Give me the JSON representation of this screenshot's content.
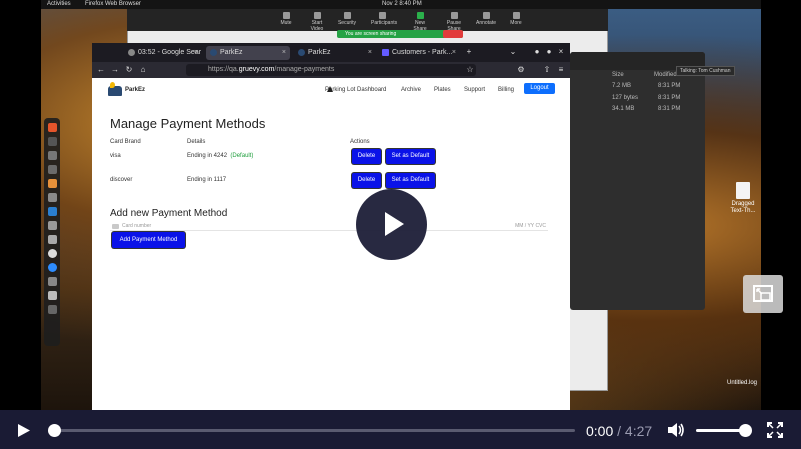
{
  "system_bar": {
    "activities": "Activities",
    "app": "Firefox Web Browser",
    "clock": "Nov 2  8:40 PM"
  },
  "zoom_toolbar": {
    "items": [
      "Mute",
      "Start Video",
      "Security",
      "Participants",
      "New Share",
      "Pause Share",
      "Annotate",
      "More"
    ],
    "share_status": "You are screen sharing"
  },
  "files_window": {
    "columns": [
      "Size",
      "Modified"
    ],
    "rows": [
      {
        "size": "7.2 MB",
        "modified": "8:31 PM"
      },
      {
        "size": "127 bytes",
        "modified": "8:31 PM"
      },
      {
        "size": "34.1 MB",
        "modified": "8:31 PM"
      }
    ],
    "talking": "Talking: Tom Cushman"
  },
  "desktop_icons": [
    {
      "label": "Dragged Text-Th..."
    },
    {
      "label": "Untitled.log"
    }
  ],
  "browser": {
    "tabs": [
      {
        "label": "03:52 - Google Sear",
        "active": false
      },
      {
        "label": "ParkEz",
        "active": true
      },
      {
        "label": "ParkEz",
        "active": false
      },
      {
        "label": "Customers - Park...",
        "active": false
      }
    ],
    "url_prefix": "https://qa.",
    "url_domain": "gruevy.com",
    "url_path": "/manage-payments"
  },
  "site": {
    "brand": "ParkEz",
    "nav": [
      "Parking Lot Dashboard",
      "Archive",
      "Plates",
      "Support",
      "Billing"
    ],
    "logout": "Logout",
    "title": "Manage Payment Methods",
    "columns": [
      "Card Brand",
      "Details",
      "Actions"
    ],
    "methods": [
      {
        "brand": "visa",
        "details": "Ending in 4242",
        "default_tag": "(Default)",
        "delete": "Delete",
        "set_default": "Set as Default"
      },
      {
        "brand": "discover",
        "details": "Ending in 1117",
        "default_tag": "",
        "delete": "Delete",
        "set_default": "Set as Default"
      }
    ],
    "add_title": "Add new Payment Method",
    "card_placeholder": "Card number",
    "card_expiry_placeholder": "MM / YY  CVC",
    "add_button": "Add Payment Method"
  },
  "video": {
    "current_time": "0:00",
    "separator": "/",
    "duration": "4:27",
    "progress": 0.0,
    "volume": 0.9
  }
}
